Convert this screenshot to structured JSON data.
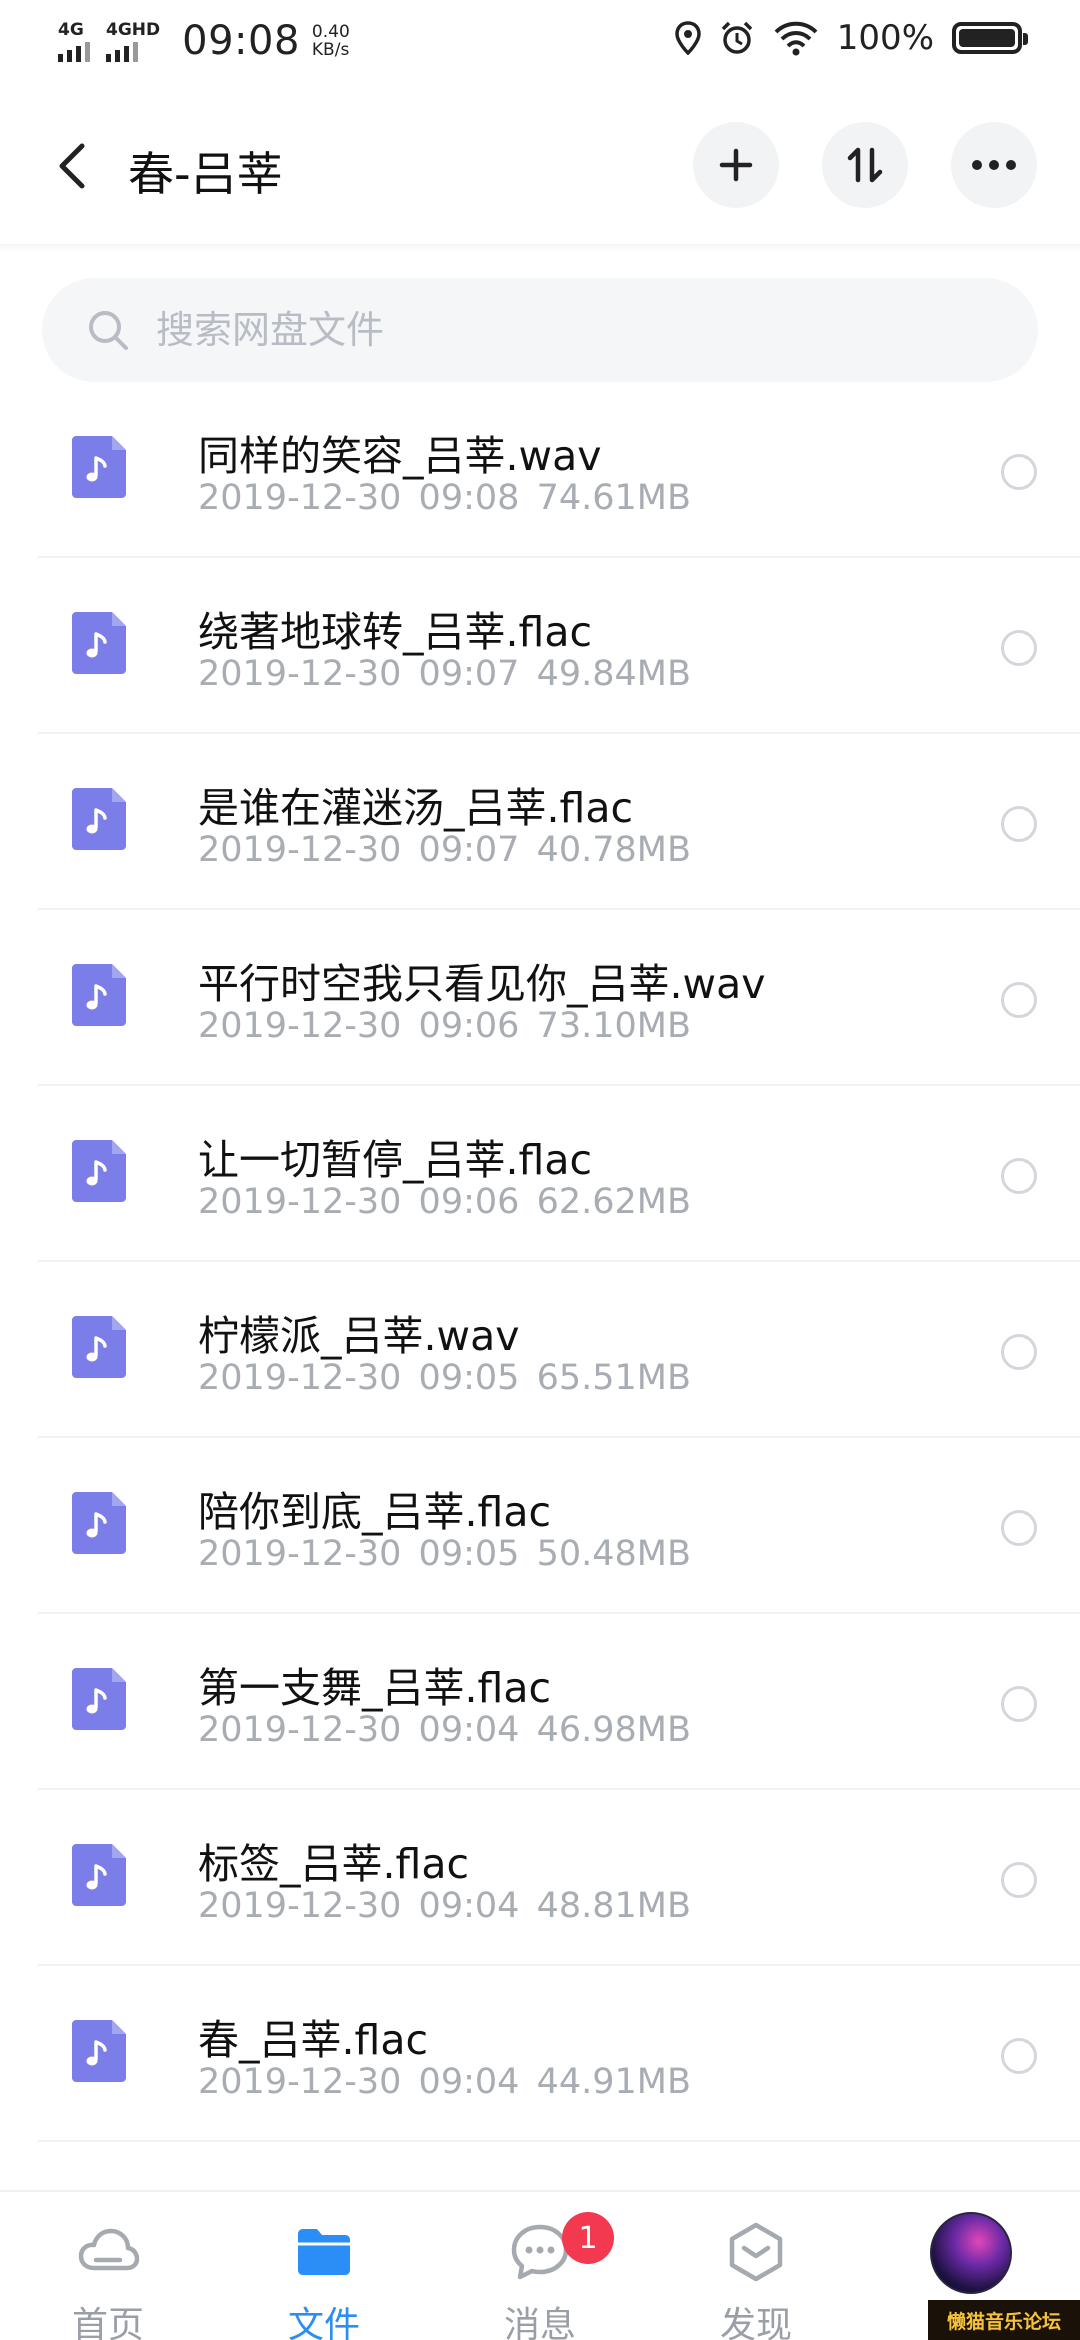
{
  "status_bar": {
    "sim1_label": "4G",
    "sim2_label": "4GHD",
    "time": "09:08",
    "speed_value": "0.40",
    "speed_unit": "KB/s",
    "battery_percent": "100%"
  },
  "header": {
    "title": "春-吕莘",
    "icons": [
      "back-arrow-icon",
      "plus-icon",
      "sort-icon",
      "more-icon"
    ]
  },
  "search": {
    "placeholder": "搜索网盘文件"
  },
  "files": [
    {
      "name": "同样的笑容_吕莘.wav",
      "date": "2019-12-30",
      "time": "09:08",
      "size": "74.61MB"
    },
    {
      "name": "绕著地球转_吕莘.flac",
      "date": "2019-12-30",
      "time": "09:07",
      "size": "49.84MB"
    },
    {
      "name": "是谁在灌迷汤_吕莘.flac",
      "date": "2019-12-30",
      "time": "09:07",
      "size": "40.78MB"
    },
    {
      "name": "平行时空我只看见你_吕莘.wav",
      "date": "2019-12-30",
      "time": "09:06",
      "size": "73.10MB"
    },
    {
      "name": "让一切暂停_吕莘.flac",
      "date": "2019-12-30",
      "time": "09:06",
      "size": "62.62MB"
    },
    {
      "name": "柠檬派_吕莘.wav",
      "date": "2019-12-30",
      "time": "09:05",
      "size": "65.51MB"
    },
    {
      "name": "陪你到底_吕莘.flac",
      "date": "2019-12-30",
      "time": "09:05",
      "size": "50.48MB"
    },
    {
      "name": "第一支舞_吕莘.flac",
      "date": "2019-12-30",
      "time": "09:04",
      "size": "46.98MB"
    },
    {
      "name": "标签_吕莘.flac",
      "date": "2019-12-30",
      "time": "09:04",
      "size": "48.81MB"
    },
    {
      "name": "春_吕莘.flac",
      "date": "2019-12-30",
      "time": "09:04",
      "size": "44.91MB"
    }
  ],
  "bottom_nav": {
    "items": [
      {
        "label": "首页",
        "icon": "cloud-icon",
        "active": false
      },
      {
        "label": "文件",
        "icon": "folder-icon",
        "active": true
      },
      {
        "label": "消息",
        "icon": "message-icon",
        "active": false,
        "badge": "1"
      },
      {
        "label": "发现",
        "icon": "discover-icon",
        "active": false
      }
    ]
  },
  "watermark": "懒猫音乐论坛",
  "colors": {
    "accent": "#2b8ef7",
    "file_icon": "#7b7de8",
    "badge": "#f2394f",
    "meta_text": "#a8acb3"
  }
}
